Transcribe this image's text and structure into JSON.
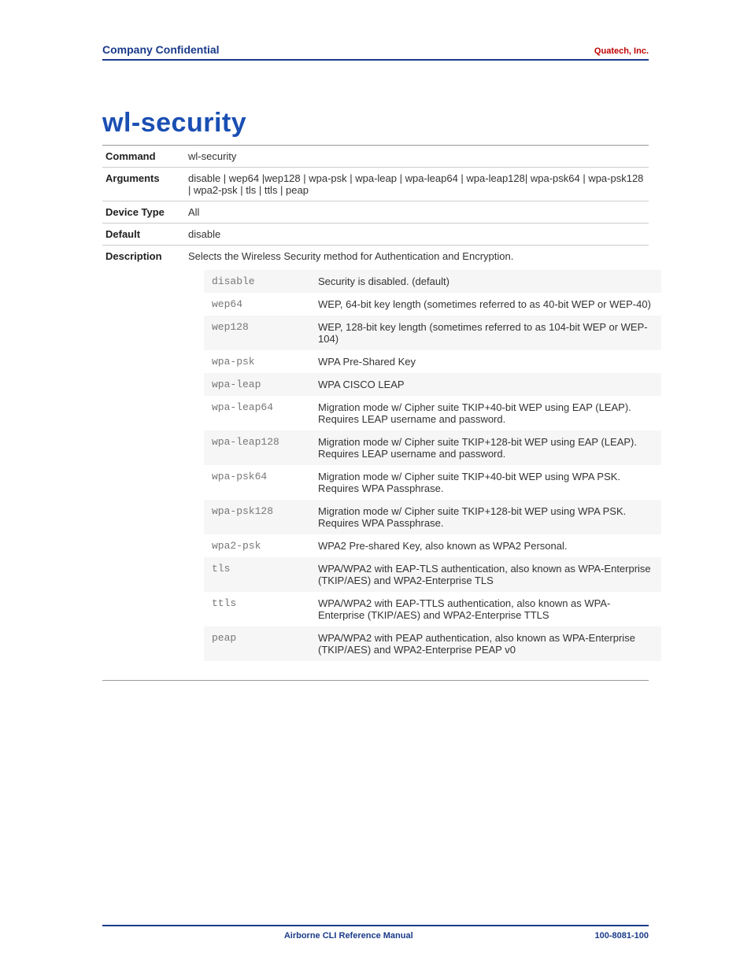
{
  "header": {
    "left": "Company Confidential",
    "right": "Quatech, Inc."
  },
  "title": "wl-security",
  "meta": {
    "command_label": "Command",
    "command_value": "wl-security",
    "arguments_label": "Arguments",
    "arguments_value": "disable | wep64 |wep128 | wpa-psk | wpa-leap | wpa-leap64 | wpa-leap128| wpa-psk64 | wpa-psk128 | wpa2-psk | tls | ttls | peap",
    "devicetype_label": "Device Type",
    "devicetype_value": "All",
    "default_label": "Default",
    "default_value": "disable",
    "description_label": "Description",
    "description_value": "Selects the Wireless Security method for Authentication and Encryption."
  },
  "args": [
    {
      "name": "disable",
      "desc": "Security is disabled. (default)"
    },
    {
      "name": "wep64",
      "desc": "WEP, 64-bit key length (sometimes referred to as 40-bit WEP or WEP-40)"
    },
    {
      "name": "wep128",
      "desc": "WEP, 128-bit key length (sometimes referred to as 104-bit WEP or WEP-104)"
    },
    {
      "name": "wpa-psk",
      "desc": "WPA Pre-Shared Key"
    },
    {
      "name": "wpa-leap",
      "desc": "WPA CISCO LEAP"
    },
    {
      "name": "wpa-leap64",
      "desc": "Migration mode w/ Cipher suite TKIP+40-bit WEP using EAP (LEAP). Requires LEAP username and password."
    },
    {
      "name": "wpa-leap128",
      "desc": "Migration mode w/ Cipher suite TKIP+128-bit WEP using EAP (LEAP). Requires LEAP username and password."
    },
    {
      "name": "wpa-psk64",
      "desc": "Migration mode w/ Cipher suite TKIP+40-bit WEP using WPA PSK. Requires WPA Passphrase."
    },
    {
      "name": "wpa-psk128",
      "desc": "Migration mode w/ Cipher suite TKIP+128-bit WEP using WPA PSK. Requires WPA Passphrase."
    },
    {
      "name": "wpa2-psk",
      "desc": "WPA2 Pre-shared Key, also known as WPA2 Personal."
    },
    {
      "name": "tls",
      "desc": "WPA/WPA2 with EAP-TLS authentication, also known as WPA-Enterprise (TKIP/AES) and WPA2-Enterprise TLS"
    },
    {
      "name": "ttls",
      "desc": "WPA/WPA2 with EAP-TTLS authentication, also known as WPA-Enterprise (TKIP/AES) and WPA2-Enterprise TTLS"
    },
    {
      "name": "peap",
      "desc": "WPA/WPA2 with PEAP authentication, also known as WPA-Enterprise (TKIP/AES) and WPA2-Enterprise PEAP v0"
    }
  ],
  "footer": {
    "center": "Airborne CLI Reference Manual",
    "right": "100-8081-100"
  }
}
